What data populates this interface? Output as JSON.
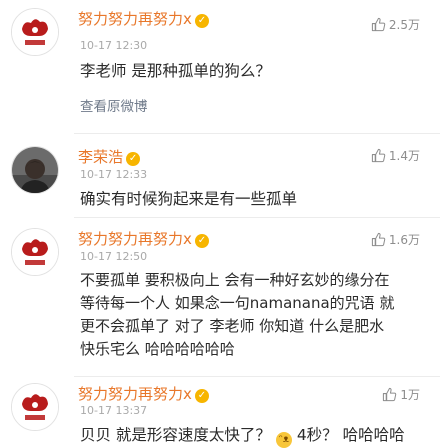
{
  "comments": [
    {
      "name": "努力努力再努力x",
      "time": "10-17 12:30",
      "likes": "2.5万",
      "text": "李老师 是那种孤单的狗么？",
      "link": "查看原微博"
    },
    {
      "name": "李荣浩",
      "time": "10-17 12:33",
      "likes": "1.4万",
      "text": "确实有时候狗起来是有一些孤单"
    },
    {
      "name": "努力努力再努力x",
      "time": "10-17 12:50",
      "likes": "1.6万",
      "lines": [
        "不要孤单 要积极向上 会有一种好玄妙的缘分在",
        "等待每一个人 如果念一句namanana的咒语 就",
        "更不会孤单了 对了 李老师 你知道 什么是肥水",
        "快乐宅么 哈哈哈哈哈哈"
      ]
    },
    {
      "name": "努力努力再努力x",
      "time": "10-17 13:37",
      "likes": "1万",
      "text_before": "贝贝 就是形容速度太快了？",
      "text_after": "4秒？ 哈哈哈哈"
    }
  ],
  "icons": {
    "badge": "verified-badge-icon",
    "like": "thumbs-up-icon",
    "emoji": "grinning-emoji-icon"
  },
  "colors": {
    "name": "#e8772a",
    "badge": "#f7b500",
    "time": "#a9a9a9",
    "text": "#2b2b2b",
    "link": "#6f7a8a"
  }
}
